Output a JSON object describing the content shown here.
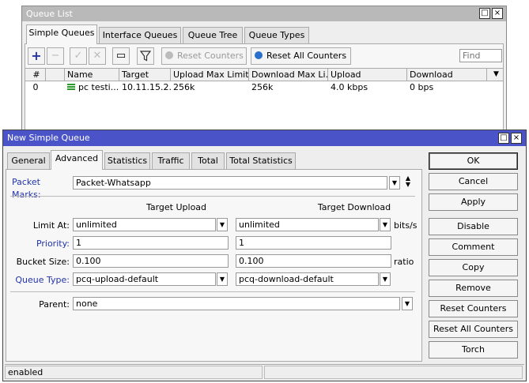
{
  "queue_list": {
    "title": "Queue List",
    "min_icon": "□",
    "close_icon": "×",
    "tabs": [
      "Simple Queues",
      "Interface Queues",
      "Queue Tree",
      "Queue Types"
    ],
    "toolbar": {
      "add": "+",
      "remove": "−",
      "enable": "✓",
      "disable": "✕",
      "comment": "▭",
      "filter": "⚲",
      "reset_counters": "Reset Counters",
      "reset_all_counters": "Reset All Counters",
      "find_placeholder": "Find"
    },
    "columns": [
      "#",
      "Name",
      "Target",
      "Upload Max Limit",
      "Download Max Li...",
      "Upload",
      "Download"
    ],
    "rows": [
      {
        "num": "0",
        "name": "pc testi...",
        "target": "10.11.15.2...",
        "upload_max": "256k",
        "download_max": "256k",
        "upload": "4.0 kbps",
        "download": "0 bps"
      }
    ]
  },
  "new_queue": {
    "title": "New Simple Queue",
    "min_icon": "□",
    "close_icon": "×",
    "tabs": [
      "General",
      "Advanced",
      "Statistics",
      "Traffic",
      "Total",
      "Total Statistics"
    ],
    "packet_marks_label": "Packet Marks:",
    "packet_marks_value": "Packet-Whatsapp",
    "col_target_upload": "Target Upload",
    "col_target_download": "Target Download",
    "limit_at_label": "Limit At:",
    "limit_at_upload": "unlimited",
    "limit_at_download": "unlimited",
    "limit_at_unit": "bits/s",
    "priority_label": "Priority:",
    "priority_upload": "1",
    "priority_download": "1",
    "bucket_size_label": "Bucket Size:",
    "bucket_upload": "0.100",
    "bucket_download": "0.100",
    "bucket_unit": "ratio",
    "queue_type_label": "Queue Type:",
    "queue_type_upload": "pcq-upload-default",
    "queue_type_download": "pcq-download-default",
    "parent_label": "Parent:",
    "parent_value": "none",
    "buttons": [
      "OK",
      "Cancel",
      "Apply",
      "Disable",
      "Comment",
      "Copy",
      "Remove",
      "Reset Counters",
      "Reset All Counters",
      "Torch"
    ],
    "status": "enabled"
  },
  "colors": {
    "inactive_title": "#b9b9b9",
    "active_title": "#4a54c8",
    "link_label": "#2233aa"
  }
}
